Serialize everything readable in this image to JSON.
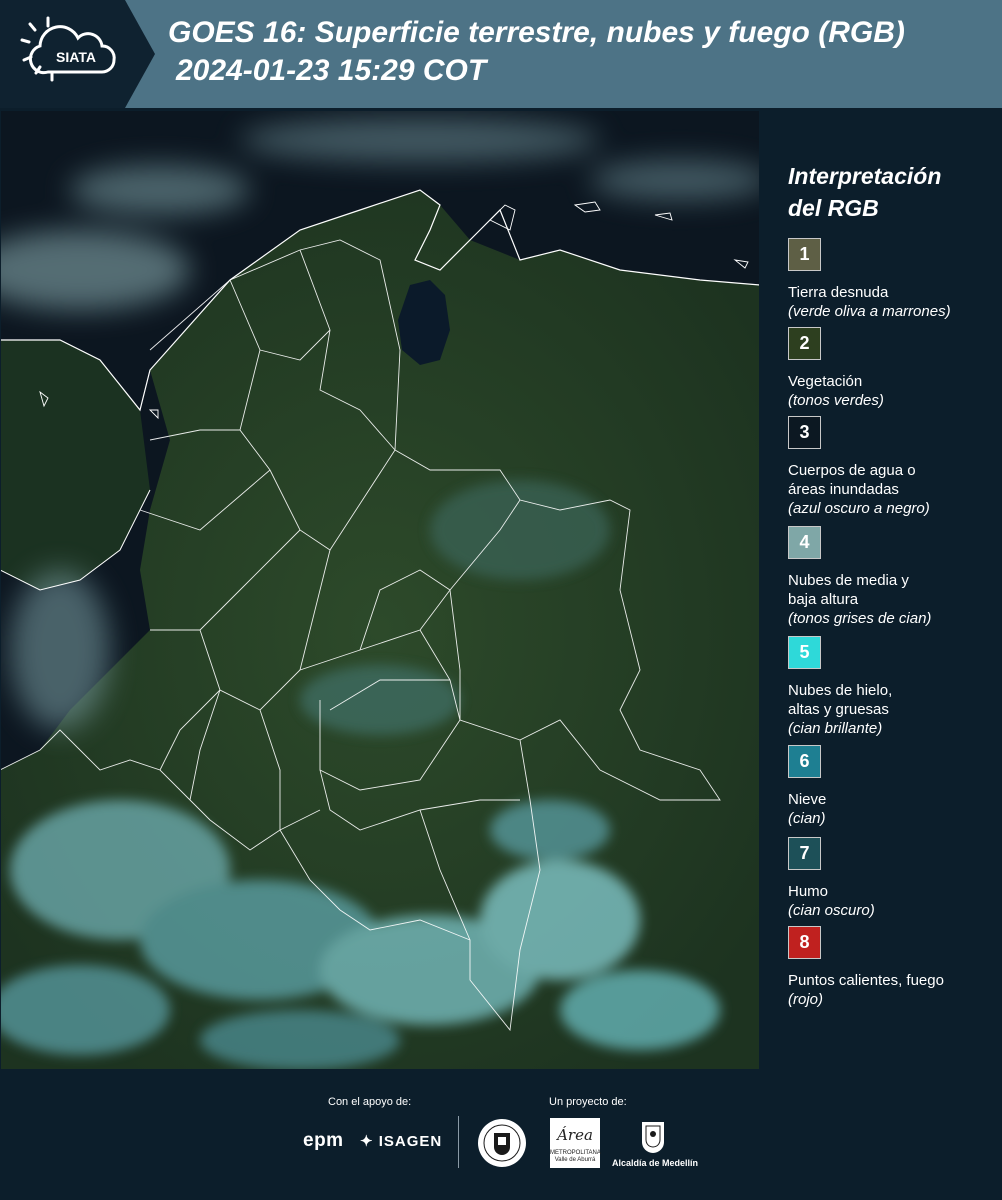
{
  "header": {
    "logo_text": "SIATA",
    "title_line1": "GOES 16: Superficie terrestre, nubes y fuego (RGB)",
    "title_line2": "2024-01-23 15:29 COT"
  },
  "legend": {
    "title_line1": "Interpretación",
    "title_line2": "del RGB",
    "items": [
      {
        "number": "1",
        "color": "#5e5f45",
        "label": "Tierra desnuda",
        "sub": "(verde oliva a marrones)"
      },
      {
        "number": "2",
        "color": "#2d3f1f",
        "label": "Vegetación",
        "sub": "(tonos verdes)"
      },
      {
        "number": "3",
        "color": "#0c1822",
        "label_lines": [
          "Cuerpos de agua o",
          "áreas inundadas"
        ],
        "sub": "(azul oscuro a negro)"
      },
      {
        "number": "4",
        "color": "#7fa7a7",
        "label_lines": [
          "Nubes de media y",
          "baja altura"
        ],
        "sub": "(tonos grises de cian)"
      },
      {
        "number": "5",
        "color": "#2ed9d9",
        "label_lines": [
          "Nubes de hielo,",
          "altas y gruesas"
        ],
        "sub": "(cian brillante)"
      },
      {
        "number": "6",
        "color": "#1e7f92",
        "label": "Nieve",
        "sub": "(cian)"
      },
      {
        "number": "7",
        "color": "#1d5058",
        "label": "Humo",
        "sub": "(cian oscuro)"
      },
      {
        "number": "8",
        "color": "#c0211f",
        "label": "Puntos calientes, fuego",
        "sub": "(rojo)"
      }
    ]
  },
  "footer": {
    "support_label": "Con el apoyo de:",
    "project_label": "Un proyecto de:",
    "epm_text": "epm",
    "isagen_text": "ISAGEN",
    "area_text": "Área",
    "area_sub": "METROPOLITANA Valle de Aburrá",
    "alcaldia_text": "Alcaldía de Medellín"
  }
}
